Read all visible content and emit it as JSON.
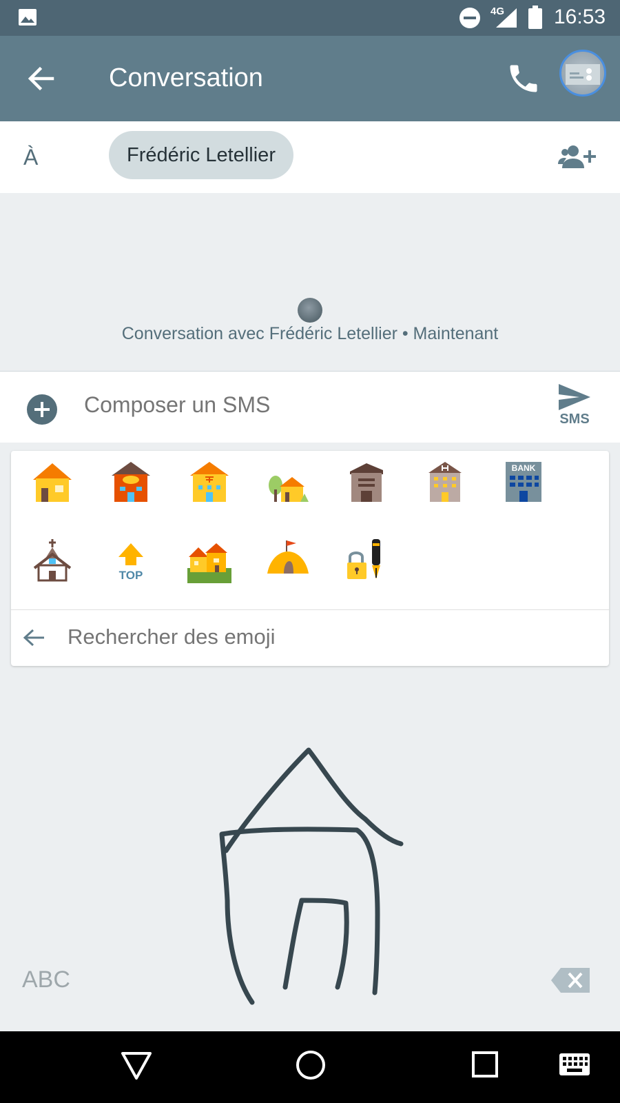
{
  "status_bar": {
    "network": "4G",
    "time": "16:53"
  },
  "app_bar": {
    "title": "Conversation"
  },
  "recipient": {
    "to_label": "À",
    "chip_name": "Frédéric Letellier"
  },
  "conversation": {
    "info": "Conversation avec Frédéric Letellier • Maintenant"
  },
  "compose": {
    "placeholder": "Composer un SMS",
    "send_label": "SMS"
  },
  "emoji_panel": {
    "search_placeholder": "Rechercher des emoji",
    "emojis": [
      "house-emoji",
      "post-office-emoji",
      "japanese-post-office-emoji",
      "house-with-garden-emoji",
      "derelict-house-emoji",
      "hospital-emoji",
      "bank-emoji",
      "church-emoji",
      "top-arrow-emoji",
      "houses-emoji",
      "camping-tent-emoji",
      "locked-with-pen-emoji"
    ],
    "bank_text": "BANK",
    "top_text": "TOP"
  },
  "keyboard": {
    "mode_label": "ABC"
  },
  "colors": {
    "status_bar": "#4e6674",
    "app_bar": "#607d8b",
    "accent": "#607d8b",
    "ink": "#37474f"
  }
}
